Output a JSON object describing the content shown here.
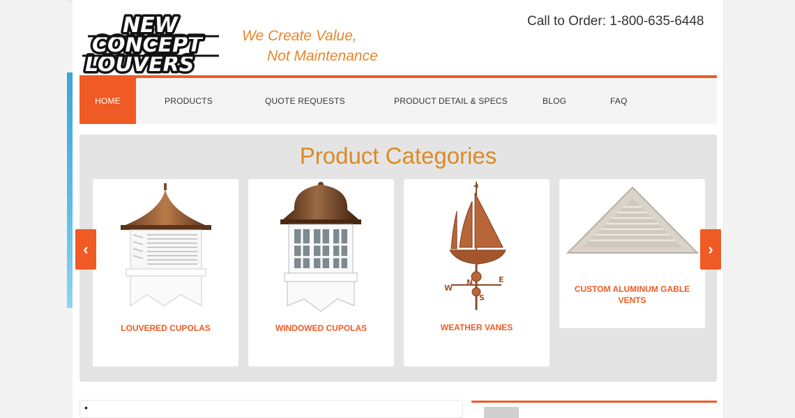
{
  "brand": {
    "logo_lines": [
      "NEW",
      "CONCEPT",
      "LOUVERS"
    ],
    "tagline_line1": "We Create Value,",
    "tagline_line2": "Not Maintenance",
    "phone": "Call to Order: 1-800-635-6448"
  },
  "nav": {
    "items": [
      {
        "label": "HOME",
        "active": true
      },
      {
        "label": "PRODUCTS"
      },
      {
        "label": "QUOTE REQUESTS"
      },
      {
        "label": "PRODUCT DETAIL & SPECS"
      },
      {
        "label": "BLOG"
      },
      {
        "label": "FAQ"
      }
    ]
  },
  "categories": {
    "title": "Product Categories",
    "items": [
      {
        "label": "LOUVERED CUPOLAS",
        "icon": "louvered-cupola-image"
      },
      {
        "label": "WINDOWED CUPOLAS",
        "icon": "windowed-cupola-image"
      },
      {
        "label": "WEATHER VANES",
        "icon": "weather-vane-image"
      },
      {
        "label": "CUSTOM ALUMINUM GABLE VENTS",
        "icon": "gable-vent-image"
      }
    ],
    "prev_icon": "chevron-left-icon",
    "next_icon": "chevron-right-icon"
  },
  "bottom": {
    "bullet": "•"
  },
  "colors": {
    "accent": "#f05a24",
    "title": "#d98b25",
    "tagline": "#e6862a"
  }
}
